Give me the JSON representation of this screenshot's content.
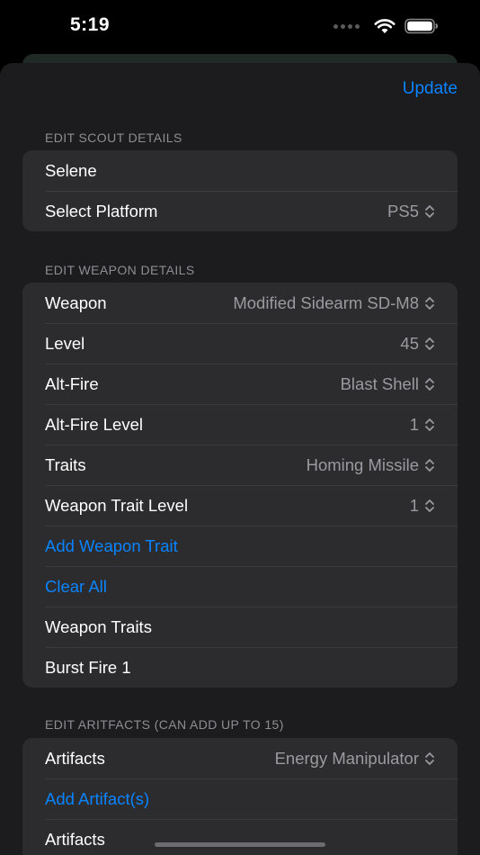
{
  "status_bar": {
    "time": "5:19"
  },
  "toolbar": {
    "update_label": "Update"
  },
  "scout": {
    "header": "Edit Scout Details",
    "name": "Selene",
    "platform_label": "Select Platform",
    "platform_value": "PS5"
  },
  "weapon": {
    "header": "Edit Weapon Details",
    "rows": [
      {
        "label": "Weapon",
        "value": "Modified Sidearm SD-M8"
      },
      {
        "label": "Level",
        "value": "45"
      },
      {
        "label": "Alt-Fire",
        "value": "Blast Shell"
      },
      {
        "label": "Alt-Fire Level",
        "value": "1"
      },
      {
        "label": "Traits",
        "value": "Homing Missile"
      },
      {
        "label": "Weapon Trait Level",
        "value": "1"
      }
    ],
    "add_trait_label": "Add Weapon Trait",
    "clear_all_label": "Clear All",
    "traits_title": "Weapon Traits",
    "trait_items": [
      "Burst Fire 1"
    ]
  },
  "artifacts": {
    "header": "Edit Aritfacts (Can add up to 15)",
    "artifact_label": "Artifacts",
    "artifact_value": "Energy Manipulator",
    "add_label": "Add Artifact(s)",
    "list_title": "Artifacts"
  },
  "colors": {
    "accent": "#0a84ff",
    "sheet_bg": "#1c1c1e",
    "cell_bg": "#2c2c2e",
    "secondary_text": "#9a9aa0"
  }
}
